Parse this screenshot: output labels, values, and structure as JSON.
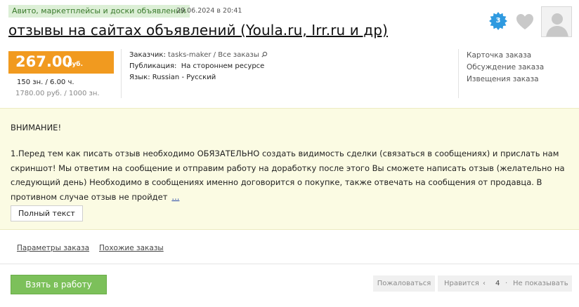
{
  "order": {
    "category": "Авито, маркетплейсы и доски объявлений",
    "date": "29.06.2024 в 20:41",
    "title": "отзывы на сайтах объявлений (Youla.ru, Irr.ru и др)",
    "views_count": "3"
  },
  "price": {
    "value": "267.00",
    "currency": "руб.",
    "line1": "150 зн. / 6.00 ч.",
    "line2": "1780.00 руб. / 1000 зн."
  },
  "meta": {
    "customer_label": "Заказчик:",
    "customer_name": "tasks-maker",
    "all_orders_link": "Все заказы",
    "publication_label": "Публикация:",
    "publication_value": "На стороннем ресурсе",
    "language_label": "Язык:",
    "language_value": "Russian - Русский"
  },
  "side_links": {
    "order_card": "Карточка заказа",
    "order_discussion": "Обсуждение заказа",
    "order_notifications": "Извещения заказа"
  },
  "notice": {
    "heading": "ВНИМАНИЕ!",
    "body": "1.Перед тем как писать отзыв необходимо ОБЯЗАТЕЛЬНО создать видимость сделки (связаться в сообщениях) и прислать нам скриншот! Мы ответим на сообщение и отправим работу на доработку после этого Вы сможете написать отзыв (желательно на следующий день) Необходимо в сообщениях именно договорится о покупке, также отвечать на сообщения от продавца. В противном случае отзыв не пройдет",
    "more_link": "...",
    "full_text_button": "Полный текст"
  },
  "tabs": {
    "order_params": "Параметры заказа",
    "similar_orders": "Похожие заказы"
  },
  "actions": {
    "take_button": "Взять в работу",
    "complain": "Пожаловаться",
    "like": "Нравится",
    "like_count": "4",
    "hide": "Не показывать"
  },
  "colors": {
    "price_bg": "#f19a1f",
    "category_bg": "#dcefd6",
    "category_text": "#3a7a2c",
    "notice_bg": "#fbfbe3",
    "take_button_bg": "#7cc05a",
    "badge_blue": "#2f9ae0"
  },
  "icons": {
    "views_badge": "starburst-badge-icon",
    "favorite": "heart-icon",
    "customer_avatar": "user-placeholder-icon",
    "all_orders": "search-icon"
  }
}
